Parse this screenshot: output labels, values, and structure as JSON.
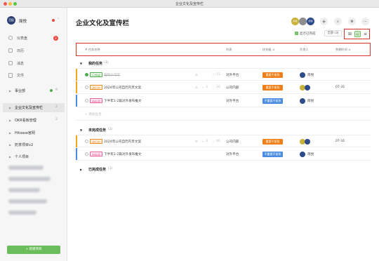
{
  "window": {
    "title": "企业文化及宣传栏"
  },
  "sidebar": {
    "team_badge": "百配",
    "team_name": "简悦",
    "nav": [
      {
        "label": "仪表盘",
        "badge": "2"
      },
      {
        "label": "日历"
      },
      {
        "label": "消息"
      },
      {
        "label": "文件"
      }
    ],
    "projects": [
      {
        "label": "事业部",
        "count": "9"
      },
      {
        "label": "企业文化及宣传栏",
        "count": "2"
      },
      {
        "label": "OKR看板管理",
        "count": "2"
      },
      {
        "label": "Hitoase官网"
      },
      {
        "label": "奶茶项目v2"
      },
      {
        "label": "个人项目"
      }
    ],
    "new_project_label": "+ 新建项目"
  },
  "header": {
    "title": "企业文化及宣传栏",
    "show_done_label": "显示已完成",
    "filter_label": "全部 (3)",
    "members": [
      {
        "initials": "简悦",
        "color": "#c9b23a"
      },
      {
        "initials": "",
        "color": "#8d8d8d"
      },
      {
        "initials": "简悦",
        "color": "#2d4a8a"
      }
    ]
  },
  "table": {
    "columns": [
      "# 任务名称",
      "列表",
      "优先级 ≎",
      "负责人",
      "到期时间 ≎"
    ],
    "groups": [
      {
        "name": "我的任务",
        "count": "(3)",
        "tasks": [
          {
            "bar": "#f2a51a",
            "status": "已完成",
            "status_color": "#4cae4c",
            "title": "临时小可可",
            "done": true,
            "sub": "",
            "comments": "15",
            "list": "对外平台",
            "priority": "重要不紧急",
            "priority_color": "#f07f17",
            "assignee": "简悦",
            "due": ""
          },
          {
            "bar": "#f2a51a",
            "status": "进行中",
            "status_color": "#e88a1c",
            "title": "2024年公司自历内页文案",
            "done": false,
            "sub": "3",
            "comments": "16",
            "list": "公司内部",
            "priority": "重要不紧急",
            "priority_color": "#f07f17",
            "assignee": "简悦",
            "due": "07-31"
          },
          {
            "bar": "#4a8de0",
            "status": "待处理",
            "status_color": "#e85b9a",
            "title": "下半年1-2篇对外发布推文",
            "done": false,
            "sub": "",
            "comments": "",
            "list": "对外平台",
            "priority": "不重要不紧急",
            "priority_color": "#4a8de0",
            "assignee": "简悦",
            "due": ""
          }
        ],
        "add_label": "+ 添加任务"
      },
      {
        "name": "未完成任务",
        "count": "(2)",
        "tasks": [
          {
            "bar": "#f2a51a",
            "status": "进行中",
            "status_color": "#e88a1c",
            "title": "2024年公司自历内页文案",
            "done": false,
            "sub": "3",
            "comments": "16",
            "list": "公司内部",
            "priority": "重要不紧急",
            "priority_color": "#f07f17",
            "assignee": "简悦",
            "due": "07-31"
          },
          {
            "bar": "#4a8de0",
            "status": "待处理",
            "status_color": "#e85b9a",
            "title": "下半年1-2篇对外发布推文",
            "done": false,
            "sub": "",
            "comments": "",
            "list": "对外平台",
            "priority": "不重要不紧急",
            "priority_color": "#4a8de0",
            "assignee": "简悦",
            "due": ""
          }
        ]
      },
      {
        "name": "已完成任务",
        "count": "(1)"
      }
    ]
  }
}
